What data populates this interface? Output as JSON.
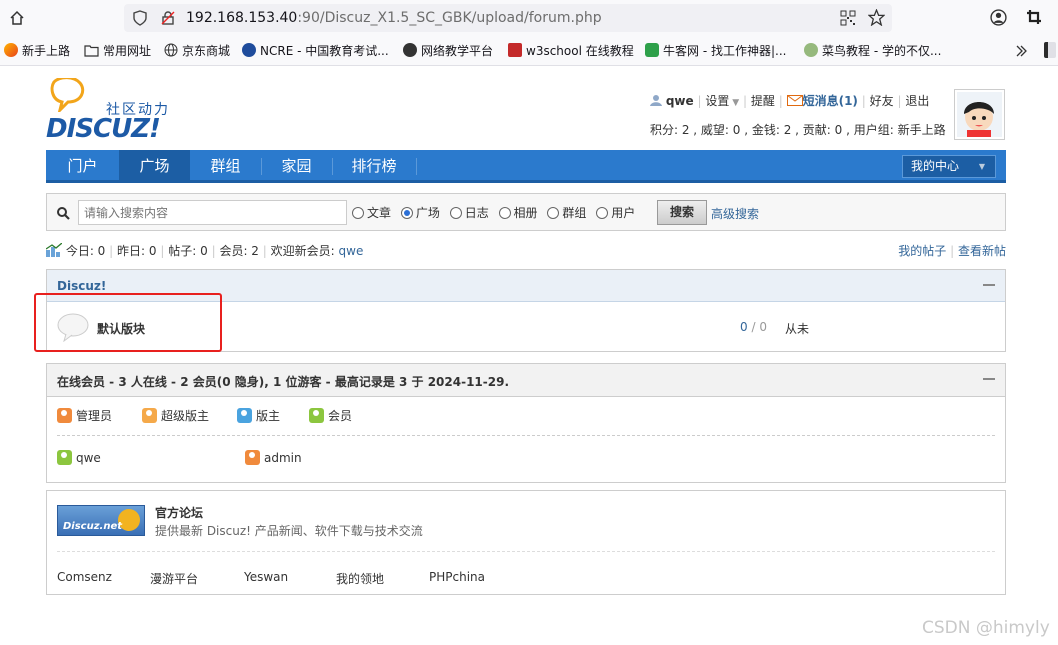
{
  "browser": {
    "url_host": "192.168.153.40",
    "url_rest": ":90/Discuz_X1.5_SC_GBK/upload/forum.php",
    "bookmarks": [
      {
        "label": "新手上路",
        "color": "#e8671c"
      },
      {
        "label": "常用网址",
        "color": "#555555"
      },
      {
        "label": "京东商城",
        "color": "#555555"
      },
      {
        "label": "NCRE - 中国教育考试...",
        "color": "#1f4c9c"
      },
      {
        "label": "网络教学平台",
        "color": "#333333"
      },
      {
        "label": "w3school 在线教程",
        "color": "#c42a2a"
      },
      {
        "label": "牛客网 - 找工作神器|...",
        "color": "#2ea04a"
      },
      {
        "label": "菜鸟教程 - 学的不仅..."
      }
    ]
  },
  "logo": {
    "tagline": "社区动力",
    "text": "DISCUZ!"
  },
  "user": {
    "name": "qwe",
    "settings": "设置",
    "remind": "提醒",
    "messages": "短消息(1)",
    "friends": "好友",
    "logout": "退出",
    "stats": "积分: 2 , 威望: 0 , 金钱: 2 , 贡献: 0 , 用户组: 新手上路"
  },
  "nav": {
    "items": [
      "门户",
      "广场",
      "群组",
      "家园",
      "排行榜"
    ],
    "my_center": "我的中心"
  },
  "search": {
    "placeholder": "请输入搜索内容",
    "options": [
      "文章",
      "广场",
      "日志",
      "相册",
      "群组",
      "用户"
    ],
    "selected": "广场",
    "button": "搜索",
    "advanced": "高级搜索"
  },
  "stats_bar": {
    "today": "今日: 0",
    "yesterday": "昨日: 0",
    "posts": "帖子: 0",
    "members": "会员: 2",
    "welcome": "欢迎新会员:",
    "new_member": "qwe",
    "my_posts": "我的帖子",
    "new_posts": "查看新帖"
  },
  "forum_category": {
    "title": "Discuz!",
    "forum_name": "默认版块",
    "topics": "0",
    "posts": "0",
    "last": "从未"
  },
  "online": {
    "title": "在线会员 - 3 人在线 - 2 会员(0 隐身), 1 位游客 - 最高记录是 3 于 2024-11-29.",
    "groups": [
      {
        "label": "管理员",
        "color": "#f08a3c"
      },
      {
        "label": "超级版主",
        "color": "#f5a94a"
      },
      {
        "label": "版主",
        "color": "#4aa3df"
      },
      {
        "label": "会员",
        "color": "#8cc63f"
      }
    ],
    "users": [
      {
        "label": "qwe",
        "color": "#8cc63f"
      },
      {
        "label": "admin",
        "color": "#f08a3c"
      }
    ]
  },
  "links": {
    "title": "官方论坛",
    "desc": "提供最新 Discuz! 产品新闻、软件下载与技术交流",
    "badge": "Discuz.net",
    "items": [
      "Comsenz",
      "漫游平台",
      "Yeswan",
      "我的领地",
      "PHPchina"
    ]
  },
  "watermark": "CSDN @himyly"
}
